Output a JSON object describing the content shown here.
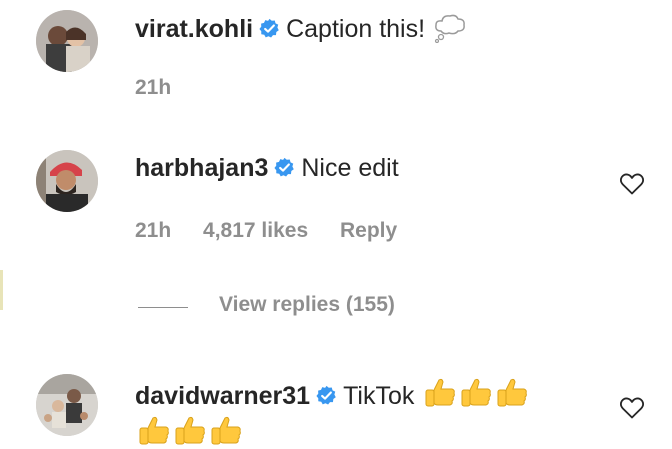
{
  "comments": [
    {
      "username": "virat.kohli",
      "text": "Caption this!",
      "emoji": "thought-balloon",
      "time": "21h"
    },
    {
      "username": "harbhajan3",
      "text": "Nice edit",
      "time": "21h",
      "likes": "4,817 likes",
      "reply": "Reply"
    },
    {
      "username": "davidwarner31",
      "text": "TikTok",
      "emoji": "thumbs-up"
    }
  ],
  "view_replies": "View replies (155)",
  "colors": {
    "text": "#262626",
    "muted": "#8e8e8e",
    "verified": "#3897f0",
    "thumbs": "#ffc83d"
  },
  "icons": [
    "verified-badge-icon",
    "heart-icon",
    "thought-balloon-emoji",
    "thumbs-up-emoji"
  ]
}
